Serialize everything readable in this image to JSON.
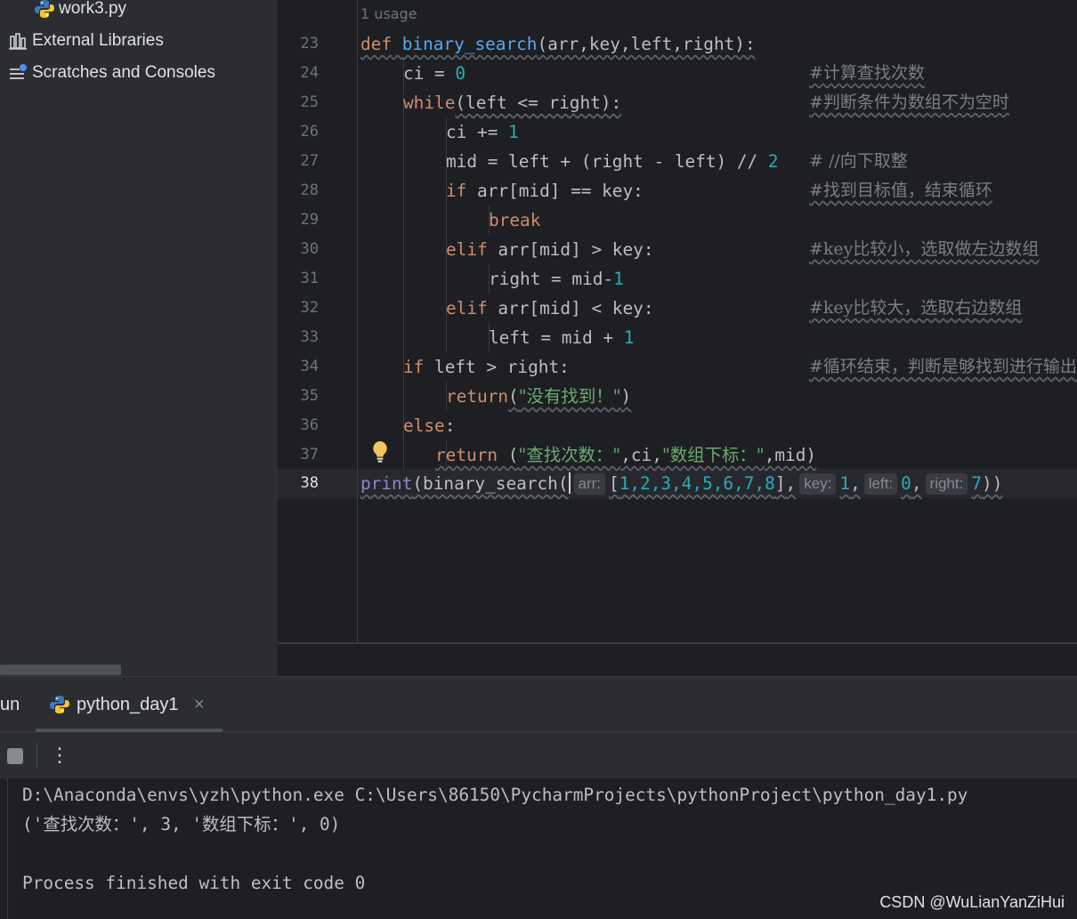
{
  "project_tree": {
    "items": [
      {
        "label": "work3.py",
        "icon": "python-file-icon"
      },
      {
        "label": "External Libraries",
        "icon": "libraries-icon"
      },
      {
        "label": "Scratches and Consoles",
        "icon": "scratches-icon"
      }
    ]
  },
  "editor": {
    "usage_hint": "1 usage",
    "lines": [
      {
        "number": "23",
        "comment": ""
      },
      {
        "number": "24",
        "comment": "#计算查找次数"
      },
      {
        "number": "25",
        "comment": "#判断条件为数组不为空时"
      },
      {
        "number": "26",
        "comment": ""
      },
      {
        "number": "27",
        "comment": "# //向下取整"
      },
      {
        "number": "28",
        "comment": "#找到目标值，结束循环"
      },
      {
        "number": "29",
        "comment": ""
      },
      {
        "number": "30",
        "comment": "#key比较小，选取做左边数组"
      },
      {
        "number": "31",
        "comment": ""
      },
      {
        "number": "32",
        "comment": "#key比较大，选取右边数组"
      },
      {
        "number": "33",
        "comment": ""
      },
      {
        "number": "34",
        "comment": "#循环结束，判断是够找到进行输出"
      },
      {
        "number": "35",
        "comment": ""
      },
      {
        "number": "36",
        "comment": ""
      },
      {
        "number": "37",
        "comment": ""
      },
      {
        "number": "38",
        "comment": ""
      }
    ],
    "code": {
      "def_kw": "def",
      "func_name": "binary_search",
      "params": "(arr,key,left,right):",
      "l24_a": "ci = ",
      "l24_num": "0",
      "while_kw": "while",
      "l25_rest": "(left <= right):",
      "l26_a": "ci += ",
      "l26_num": "1",
      "l27_a": "mid = left + (right - left) // ",
      "l27_num": "2",
      "if_kw": "if",
      "l28_rest": " arr[mid] == key:",
      "break_kw": "break",
      "elif_kw": "elif",
      "l30_rest": " arr[mid] > key:",
      "l31_a": "right = mid-",
      "l31_num": "1",
      "l32_rest": " arr[mid] < key:",
      "l33_a": "left = mid + ",
      "l33_num": "1",
      "l34_rest": " left > right:",
      "return_kw": "return",
      "l35_open": "(",
      "l35_str": "\"没有找到！\"",
      "l35_close": ")",
      "else_kw": "else",
      "l36_colon": ":",
      "l37_open": " (",
      "l37_str1": "\"查找次数：\"",
      "l37_mid": ",ci,",
      "l37_str2": "\"数组下标：\"",
      "l37_end": ",mid)",
      "print_fn": "print",
      "l38_call": "(binary_search(",
      "hint_arr": "arr:",
      "l38_list_open": "[",
      "l38_list_items": "1,2,3,4,5,6,7,8",
      "l38_list_close": "]",
      "comma": ",",
      "hint_key": "key:",
      "key_val": "1",
      "hint_left": "left:",
      "left_val": "0",
      "hint_right": "right:",
      "right_val": "7",
      "l38_close": "))"
    }
  },
  "run_panel": {
    "label": "un",
    "tab_label": "python_day1",
    "close_glyph": "×",
    "more_glyph": "⋮",
    "console": [
      "D:\\Anaconda\\envs\\yzh\\python.exe C:\\Users\\86150\\PycharmProjects\\pythonProject\\python_day1.py",
      "('查找次数：', 3, '数组下标：', 0)",
      "",
      "Process finished with exit code 0"
    ]
  },
  "watermark": "CSDN @WuLianYanZiHui",
  "colors": {
    "keyword": "#cf8e6d",
    "function": "#56a8f5",
    "number": "#2aacb8",
    "string": "#6aab73",
    "comment": "#7a7e85",
    "builtin": "#8888c6"
  }
}
